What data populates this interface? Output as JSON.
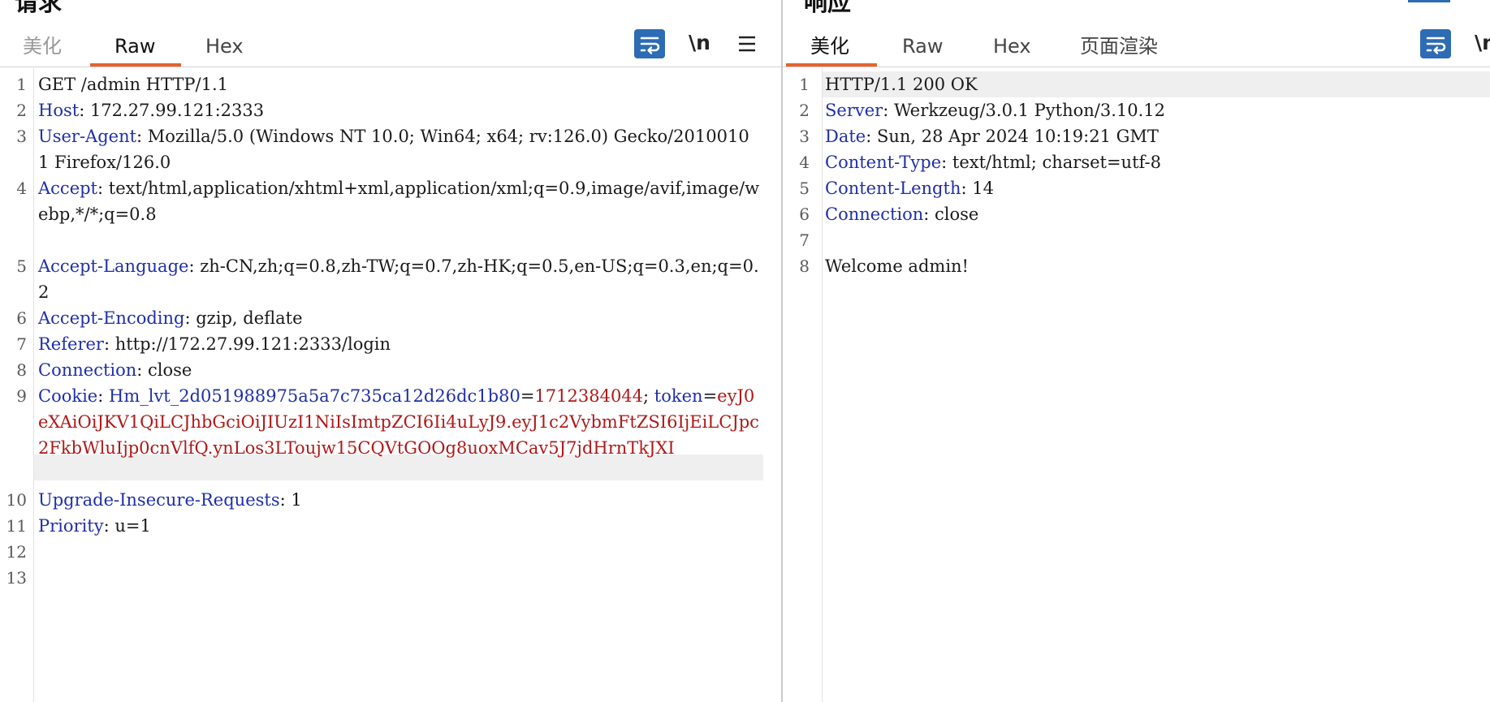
{
  "request": {
    "title": "请求",
    "tabs": [
      "美化",
      "Raw",
      "Hex"
    ],
    "active_tab": "Raw",
    "toolbar": {
      "wrap_icon": "wrap-lines-icon",
      "newline_label": "\\n",
      "menu_icon": "hamburger-menu-icon"
    },
    "lines": {
      "l1": "GET /admin HTTP/1.1",
      "l2k": "Host",
      "l2v": ": 172.27.99.121:2333",
      "l3k": "User-Agent",
      "l3v": ": Mozilla/5.0 (Windows NT 10.0; Win64; x64; rv:126.0) Gecko/20100101 Firefox/126.0",
      "l4k": "Accept",
      "l4v": ": text/html,application/xhtml+xml,application/xml;q=0.9,image/avif,image/webp,*/*;q=0.8",
      "l5k": "Accept-Language",
      "l5v": ": zh-CN,zh;q=0.8,zh-TW;q=0.7,zh-HK;q=0.5,en-US;q=0.3,en;q=0.2",
      "l6k": "Accept-Encoding",
      "l6v": ": gzip, deflate",
      "l7k": "Referer",
      "l7v": ": http://172.27.99.121:2333/login",
      "l8k": "Connection",
      "l8v": ": close",
      "l9k": "Cookie",
      "l9sep": ": ",
      "l9c1k": "Hm_lvt_2d051988975a5a7c735ca12d26dc1b80",
      "l9eq1": "=",
      "l9c1v": "1712384044",
      "l9sep2": "; ",
      "l9c2k": "token",
      "l9eq2": "=",
      "l9c2v": "eyJ0eXAiOiJKV1QiLCJhbGciOiJIUzI1NiIsImtpZCI6Ii4uLyJ9.eyJ1c2VybmFtZSI6IjEiLCJpc2FkbWluIjp0cnVlfQ.ynLos3LToujw15CQVtGOOg8uoxMCav5J7jdHrnTkJXI",
      "l10k": "Upgrade-Insecure-Requests",
      "l10v": ": 1",
      "l11k": "Priority",
      "l11v": ": u=1"
    },
    "line_numbers": [
      "1",
      "2",
      "3",
      "4",
      "5",
      "6",
      "7",
      "8",
      "9",
      "10",
      "11",
      "12",
      "13"
    ]
  },
  "response": {
    "title": "响应",
    "tabs": [
      "美化",
      "Raw",
      "Hex",
      "页面渲染"
    ],
    "active_tab": "美化",
    "toolbar": {
      "wrap_icon": "wrap-lines-icon",
      "newline_label": "\\n"
    },
    "lines": {
      "l1": "HTTP/1.1 200 OK",
      "l2k": "Server",
      "l2v": ": Werkzeug/3.0.1 Python/3.10.12",
      "l3k": "Date",
      "l3v": ": Sun, 28 Apr 2024 10:19:21 GMT",
      "l4k": "Content-Type",
      "l4v": ": text/html; charset=utf-8",
      "l5k": "Content-Length",
      "l5v": ": 14",
      "l6k": "Connection",
      "l6v": ": close",
      "l8": "Welcome admin!"
    },
    "line_numbers": [
      "1",
      "2",
      "3",
      "4",
      "5",
      "6",
      "7",
      "8"
    ]
  },
  "colors": {
    "accent_underline": "#e8612c",
    "header_key": "#1f2fa8",
    "cookie_value": "#b01818",
    "tool_button": "#2d6cb4"
  }
}
